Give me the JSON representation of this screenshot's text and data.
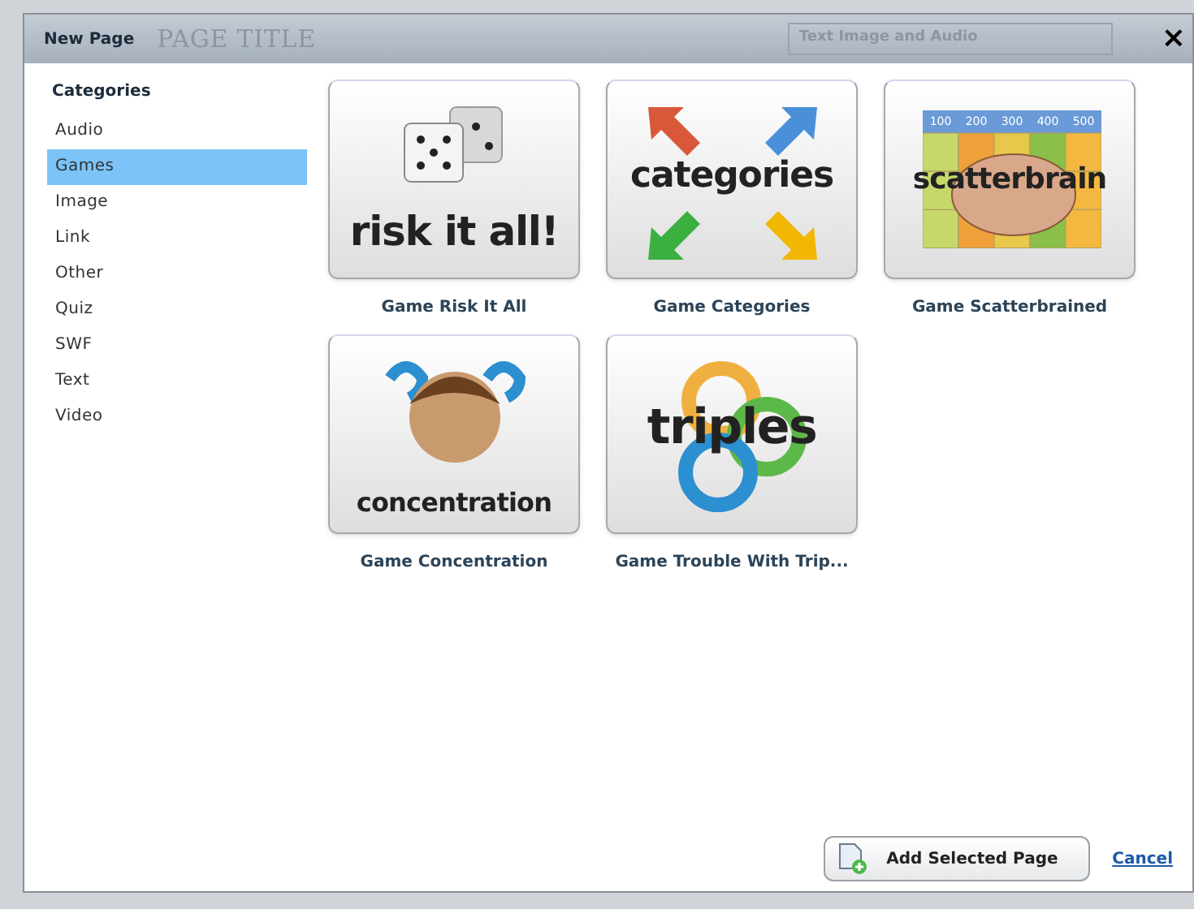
{
  "backdrop": {
    "page_title": "PAGE TITLE",
    "dropdown": "Text Image and Audio"
  },
  "window": {
    "title": "New Page",
    "close": "×"
  },
  "sidebar": {
    "heading": "Categories",
    "items": [
      {
        "label": "Audio",
        "selected": false
      },
      {
        "label": "Games",
        "selected": true
      },
      {
        "label": "Image",
        "selected": false
      },
      {
        "label": "Link",
        "selected": false
      },
      {
        "label": "Other",
        "selected": false
      },
      {
        "label": "Quiz",
        "selected": false
      },
      {
        "label": "SWF",
        "selected": false
      },
      {
        "label": "Text",
        "selected": false
      },
      {
        "label": "Video",
        "selected": false
      }
    ]
  },
  "pages": [
    {
      "kind": "dice",
      "logo": "risk it all!",
      "label": "Game Risk It All"
    },
    {
      "kind": "arrows",
      "logo": "categories",
      "label": "Game Categories"
    },
    {
      "kind": "brain",
      "logo": "scatterbrain",
      "scores": [
        "100",
        "200",
        "300",
        "400",
        "500"
      ],
      "label": "Game Scatterbrained"
    },
    {
      "kind": "face",
      "logo": "concentration",
      "label": "Game Concentration"
    },
    {
      "kind": "loops",
      "logo": "triples",
      "label": "Game Trouble With Trip..."
    }
  ],
  "buttons": {
    "add": "Add Selected Page",
    "cancel": "Cancel"
  }
}
